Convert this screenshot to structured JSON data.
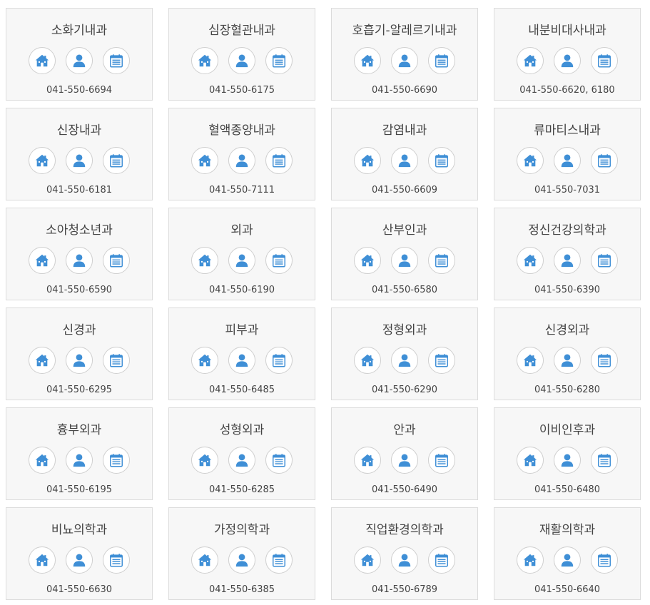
{
  "colors": {
    "icon_blue": "#3f8fd6",
    "card_bg": "#f7f7f7",
    "card_border": "#dcdcdc",
    "text": "#444444"
  },
  "icons": [
    "home-icon",
    "doctor-icon",
    "schedule-icon"
  ],
  "departments": [
    {
      "name": "소화기내과",
      "phone": "041-550-6694"
    },
    {
      "name": "심장혈관내과",
      "phone": "041-550-6175"
    },
    {
      "name": "호흡기-알레르기내과",
      "phone": "041-550-6690"
    },
    {
      "name": "내분비대사내과",
      "phone": "041-550-6620, 6180"
    },
    {
      "name": "신장내과",
      "phone": "041-550-6181"
    },
    {
      "name": "혈액종양내과",
      "phone": "041-550-7111"
    },
    {
      "name": "감염내과",
      "phone": "041-550-6609"
    },
    {
      "name": "류마티스내과",
      "phone": "041-550-7031"
    },
    {
      "name": "소아청소년과",
      "phone": "041-550-6590"
    },
    {
      "name": "외과",
      "phone": "041-550-6190"
    },
    {
      "name": "산부인과",
      "phone": "041-550-6580"
    },
    {
      "name": "정신건강의학과",
      "phone": "041-550-6390"
    },
    {
      "name": "신경과",
      "phone": "041-550-6295"
    },
    {
      "name": "피부과",
      "phone": "041-550-6485"
    },
    {
      "name": "정형외과",
      "phone": "041-550-6290"
    },
    {
      "name": "신경외과",
      "phone": "041-550-6280"
    },
    {
      "name": "흉부외과",
      "phone": "041-550-6195"
    },
    {
      "name": "성형외과",
      "phone": "041-550-6285"
    },
    {
      "name": "안과",
      "phone": "041-550-6490"
    },
    {
      "name": "이비인후과",
      "phone": "041-550-6480"
    },
    {
      "name": "비뇨의학과",
      "phone": "041-550-6630"
    },
    {
      "name": "가정의학과",
      "phone": "041-550-6385"
    },
    {
      "name": "직업환경의학과",
      "phone": "041-550-6789"
    },
    {
      "name": "재활의학과",
      "phone": "041-550-6640"
    }
  ]
}
